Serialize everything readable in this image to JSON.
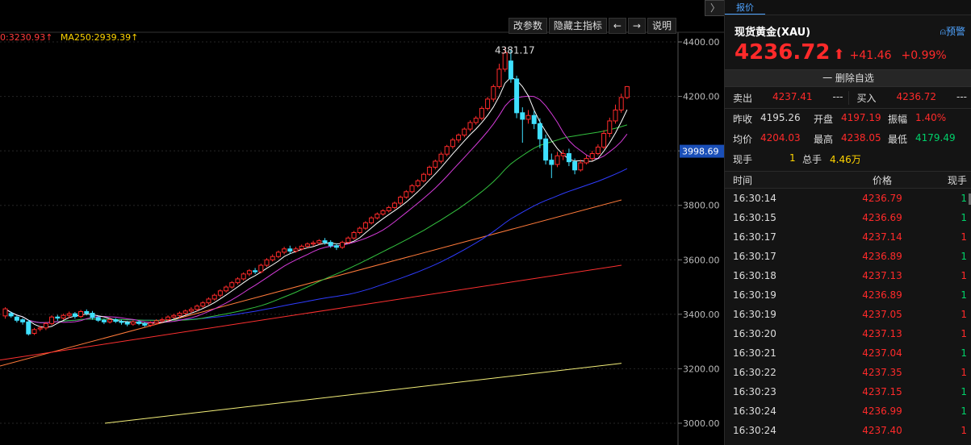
{
  "toolbar": {
    "modify_params": "改参数",
    "hide_indicators": "隐藏主指标",
    "prev": "←",
    "next": "→",
    "help": "说明"
  },
  "ma_labels": [
    {
      "text": "0:3230.93↑",
      "color": "#ff3b3b"
    },
    {
      "text": "MA250:2939.39↑",
      "color": "#ffd400"
    }
  ],
  "chart_data": {
    "type": "candlestick",
    "y_ticks": [
      "4400.00",
      "4200.00",
      "4000.00",
      "3800.00",
      "3600.00",
      "3400.00",
      "3200.00",
      "3000.00"
    ],
    "ylim": [
      2930,
      4470
    ],
    "current_price_label": "3998.69",
    "current_price": 3998.69,
    "high_annotation": "4381.17",
    "high_value": 4381.17,
    "candles": [
      [
        3394,
        3420,
        3384,
        3426
      ],
      [
        3403,
        3394,
        3387,
        3410
      ],
      [
        3390,
        3378,
        3370,
        3396
      ],
      [
        3380,
        3372,
        3362,
        3386
      ],
      [
        3372,
        3328,
        3322,
        3380
      ],
      [
        3330,
        3344,
        3324,
        3350
      ],
      [
        3346,
        3350,
        3338,
        3358
      ],
      [
        3350,
        3366,
        3342,
        3372
      ],
      [
        3366,
        3390,
        3360,
        3396
      ],
      [
        3390,
        3386,
        3376,
        3398
      ],
      [
        3386,
        3396,
        3380,
        3402
      ],
      [
        3396,
        3402,
        3386,
        3410
      ],
      [
        3402,
        3392,
        3384,
        3408
      ],
      [
        3392,
        3410,
        3386,
        3416
      ],
      [
        3410,
        3404,
        3396,
        3418
      ],
      [
        3404,
        3388,
        3380,
        3412
      ],
      [
        3388,
        3378,
        3372,
        3394
      ],
      [
        3378,
        3372,
        3364,
        3384
      ],
      [
        3372,
        3380,
        3366,
        3388
      ],
      [
        3380,
        3374,
        3368,
        3386
      ],
      [
        3374,
        3370,
        3362,
        3380
      ],
      [
        3370,
        3364,
        3356,
        3376
      ],
      [
        3364,
        3372,
        3358,
        3378
      ],
      [
        3372,
        3366,
        3360,
        3378
      ],
      [
        3366,
        3360,
        3354,
        3372
      ],
      [
        3360,
        3368,
        3354,
        3374
      ],
      [
        3368,
        3376,
        3362,
        3382
      ],
      [
        3376,
        3380,
        3370,
        3388
      ],
      [
        3380,
        3390,
        3374,
        3396
      ],
      [
        3390,
        3396,
        3384,
        3402
      ],
      [
        3396,
        3404,
        3388,
        3410
      ],
      [
        3404,
        3412,
        3398,
        3418
      ],
      [
        3412,
        3418,
        3404,
        3426
      ],
      [
        3418,
        3430,
        3412,
        3436
      ],
      [
        3430,
        3442,
        3424,
        3448
      ],
      [
        3442,
        3456,
        3436,
        3462
      ],
      [
        3456,
        3470,
        3450,
        3476
      ],
      [
        3470,
        3486,
        3462,
        3492
      ],
      [
        3486,
        3500,
        3480,
        3506
      ],
      [
        3500,
        3516,
        3494,
        3522
      ],
      [
        3516,
        3530,
        3510,
        3536
      ],
      [
        3530,
        3548,
        3524,
        3554
      ],
      [
        3548,
        3560,
        3540,
        3566
      ],
      [
        3560,
        3556,
        3548,
        3570
      ],
      [
        3556,
        3580,
        3550,
        3586
      ],
      [
        3580,
        3600,
        3574,
        3606
      ],
      [
        3600,
        3612,
        3594,
        3620
      ],
      [
        3612,
        3628,
        3606,
        3634
      ],
      [
        3628,
        3640,
        3620,
        3648
      ],
      [
        3640,
        3632,
        3622,
        3652
      ],
      [
        3632,
        3640,
        3626,
        3648
      ],
      [
        3640,
        3650,
        3634,
        3656
      ],
      [
        3650,
        3658,
        3644,
        3664
      ],
      [
        3658,
        3662,
        3650,
        3670
      ],
      [
        3662,
        3670,
        3656,
        3676
      ],
      [
        3670,
        3664,
        3656,
        3680
      ],
      [
        3664,
        3652,
        3644,
        3672
      ],
      [
        3652,
        3646,
        3636,
        3660
      ],
      [
        3646,
        3664,
        3640,
        3670
      ],
      [
        3664,
        3680,
        3658,
        3686
      ],
      [
        3680,
        3700,
        3674,
        3706
      ],
      [
        3700,
        3716,
        3694,
        3722
      ],
      [
        3716,
        3736,
        3710,
        3742
      ],
      [
        3736,
        3754,
        3730,
        3760
      ],
      [
        3754,
        3768,
        3748,
        3774
      ],
      [
        3768,
        3780,
        3762,
        3786
      ],
      [
        3780,
        3792,
        3774,
        3798
      ],
      [
        3792,
        3808,
        3786,
        3814
      ],
      [
        3808,
        3830,
        3800,
        3836
      ],
      [
        3830,
        3850,
        3824,
        3856
      ],
      [
        3850,
        3872,
        3844,
        3878
      ],
      [
        3872,
        3890,
        3866,
        3896
      ],
      [
        3890,
        3914,
        3884,
        3920
      ],
      [
        3914,
        3940,
        3908,
        3946
      ],
      [
        3940,
        3962,
        3932,
        3968
      ],
      [
        3962,
        3988,
        3954,
        3996
      ],
      [
        3988,
        4016,
        3980,
        4022
      ],
      [
        4016,
        4040,
        4008,
        4048
      ],
      [
        4040,
        4058,
        4030,
        4064
      ],
      [
        4058,
        4080,
        4050,
        4086
      ],
      [
        4080,
        4104,
        4072,
        4112
      ],
      [
        4104,
        4120,
        4096,
        4128
      ],
      [
        4120,
        4156,
        4112,
        4164
      ],
      [
        4156,
        4190,
        4148,
        4198
      ],
      [
        4190,
        4236,
        4180,
        4244
      ],
      [
        4236,
        4300,
        4228,
        4320
      ],
      [
        4300,
        4360,
        4290,
        4381
      ],
      [
        4330,
        4264,
        4250,
        4372
      ],
      [
        4264,
        4140,
        4120,
        4276
      ],
      [
        4140,
        4116,
        4030,
        4160
      ],
      [
        4116,
        4130,
        4100,
        4150
      ],
      [
        4130,
        4100,
        4080,
        4146
      ],
      [
        4100,
        4044,
        4010,
        4120
      ],
      [
        4044,
        3966,
        3950,
        4060
      ],
      [
        3966,
        3950,
        3900,
        3990
      ],
      [
        3950,
        3982,
        3940,
        3996
      ],
      [
        3982,
        3990,
        3966,
        4004
      ],
      [
        3990,
        3960,
        3944,
        4008
      ],
      [
        3960,
        3930,
        3914,
        3972
      ],
      [
        3930,
        3956,
        3924,
        3968
      ],
      [
        3956,
        3972,
        3950,
        3984
      ],
      [
        3972,
        3990,
        3964,
        4000
      ],
      [
        3990,
        4014,
        3984,
        4024
      ],
      [
        4014,
        4064,
        4006,
        4076
      ],
      [
        4064,
        4110,
        4050,
        4122
      ],
      [
        4110,
        4150,
        4100,
        4170
      ],
      [
        4150,
        4196,
        4140,
        4210
      ],
      [
        4196,
        4236,
        4190,
        4238
      ]
    ]
  },
  "panel": {
    "tab": "报价",
    "collapse": "〉",
    "title": "现货黄金(XAU)",
    "alert": "预警",
    "price": "4236.72",
    "change": "+41.46",
    "change_pct": "+0.99%",
    "remove": "一 删除自选",
    "sell_label": "卖出",
    "sell_price": "4237.41",
    "sell_vol": "---",
    "buy_label": "买入",
    "buy_price": "4236.72",
    "buy_vol": "---",
    "prev_close_label": "昨收",
    "prev_close": "4195.26",
    "open_label": "开盘",
    "open": "4197.19",
    "amp_label": "振幅",
    "amp": "1.40%",
    "avg_label": "均价",
    "avg": "4204.03",
    "high_label": "最高",
    "high": "4238.05",
    "low_label": "最低",
    "low": "4179.49",
    "cur_vol_label": "现手",
    "cur_vol": "1",
    "total_vol_label": "总手",
    "total_vol": "4.46万"
  },
  "trades_header": {
    "time": "时间",
    "price": "价格",
    "vol": "现手"
  },
  "trades": [
    {
      "time": "16:30:14",
      "price": "4236.79",
      "vol": "1",
      "vol_color": "green"
    },
    {
      "time": "16:30:15",
      "price": "4236.69",
      "vol": "1",
      "vol_color": "green"
    },
    {
      "time": "16:30:17",
      "price": "4237.14",
      "vol": "1",
      "vol_color": "red"
    },
    {
      "time": "16:30:17",
      "price": "4236.89",
      "vol": "1",
      "vol_color": "green"
    },
    {
      "time": "16:30:18",
      "price": "4237.13",
      "vol": "1",
      "vol_color": "red"
    },
    {
      "time": "16:30:19",
      "price": "4236.89",
      "vol": "1",
      "vol_color": "green"
    },
    {
      "time": "16:30:19",
      "price": "4237.05",
      "vol": "1",
      "vol_color": "red"
    },
    {
      "time": "16:30:20",
      "price": "4237.13",
      "vol": "1",
      "vol_color": "red"
    },
    {
      "time": "16:30:21",
      "price": "4237.04",
      "vol": "1",
      "vol_color": "green"
    },
    {
      "time": "16:30:22",
      "price": "4237.35",
      "vol": "1",
      "vol_color": "red"
    },
    {
      "time": "16:30:23",
      "price": "4237.15",
      "vol": "1",
      "vol_color": "green"
    },
    {
      "time": "16:30:24",
      "price": "4236.99",
      "vol": "1",
      "vol_color": "green"
    },
    {
      "time": "16:30:24",
      "price": "4237.40",
      "vol": "1",
      "vol_color": "red"
    }
  ]
}
